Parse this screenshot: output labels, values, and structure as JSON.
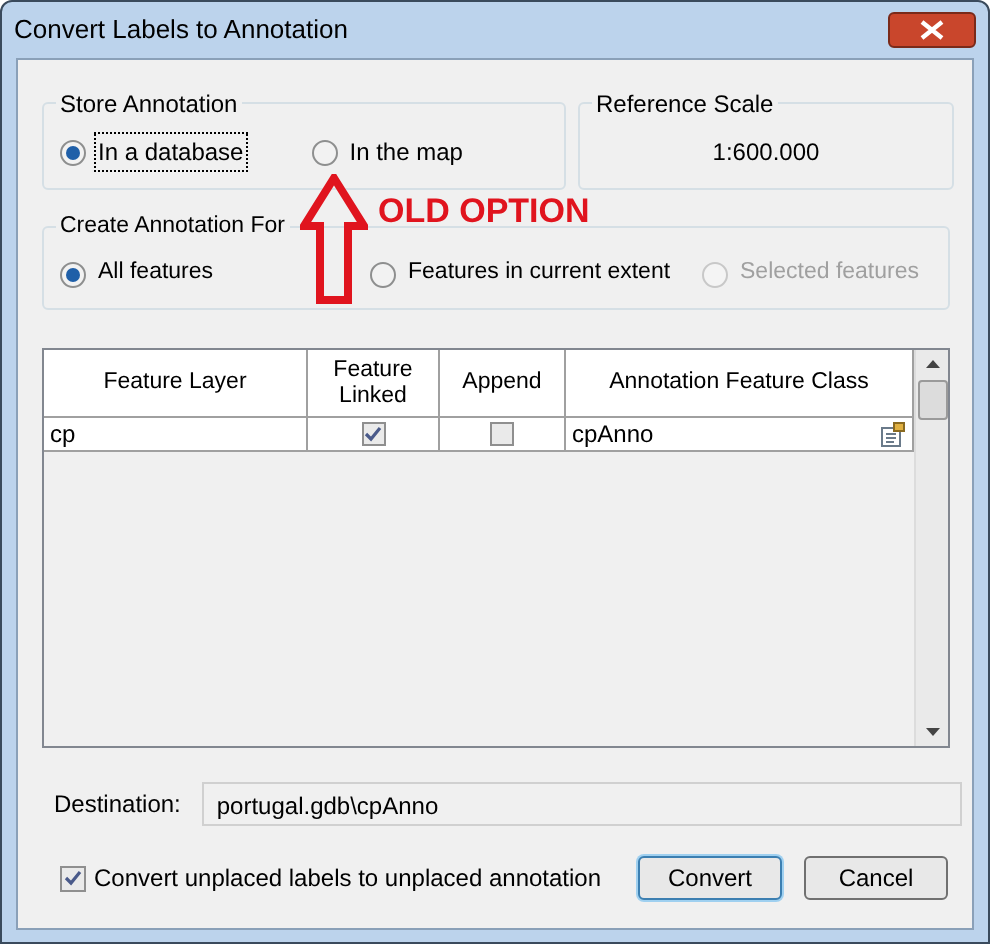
{
  "window": {
    "title": "Convert Labels to Annotation"
  },
  "store_annotation": {
    "label": "Store Annotation",
    "options": [
      {
        "label": "In a database",
        "selected": true,
        "focused": true
      },
      {
        "label": "In the map",
        "selected": false,
        "focused": false
      }
    ]
  },
  "reference_scale": {
    "label": "Reference Scale",
    "value": "1:600.000"
  },
  "create_annotation_for": {
    "label": "Create Annotation For",
    "options": [
      {
        "label": "All features",
        "selected": true,
        "disabled": false
      },
      {
        "label": "Features in current extent",
        "selected": false,
        "disabled": false
      },
      {
        "label": "Selected features",
        "selected": false,
        "disabled": true
      }
    ]
  },
  "table": {
    "columns": [
      "Feature Layer",
      "Feature Linked",
      "Append",
      "Annotation Feature Class"
    ],
    "rows": [
      [
        {
          "kind": "text",
          "text": "cp"
        },
        {
          "kind": "checkbox",
          "checked": true
        },
        {
          "kind": "checkbox",
          "checked": false
        },
        {
          "kind": "class",
          "text": "cpAnno"
        }
      ]
    ]
  },
  "destination": {
    "label": "Destination:",
    "value": "portugal.gdb\\cpAnno"
  },
  "convert_unplaced": {
    "label": "Convert unplaced labels to unplaced annotation",
    "checked": true
  },
  "buttons": [
    {
      "label": "Convert",
      "default": true
    },
    {
      "label": "Cancel",
      "default": false
    }
  ],
  "annotation": {
    "text": "OLD OPTION"
  }
}
